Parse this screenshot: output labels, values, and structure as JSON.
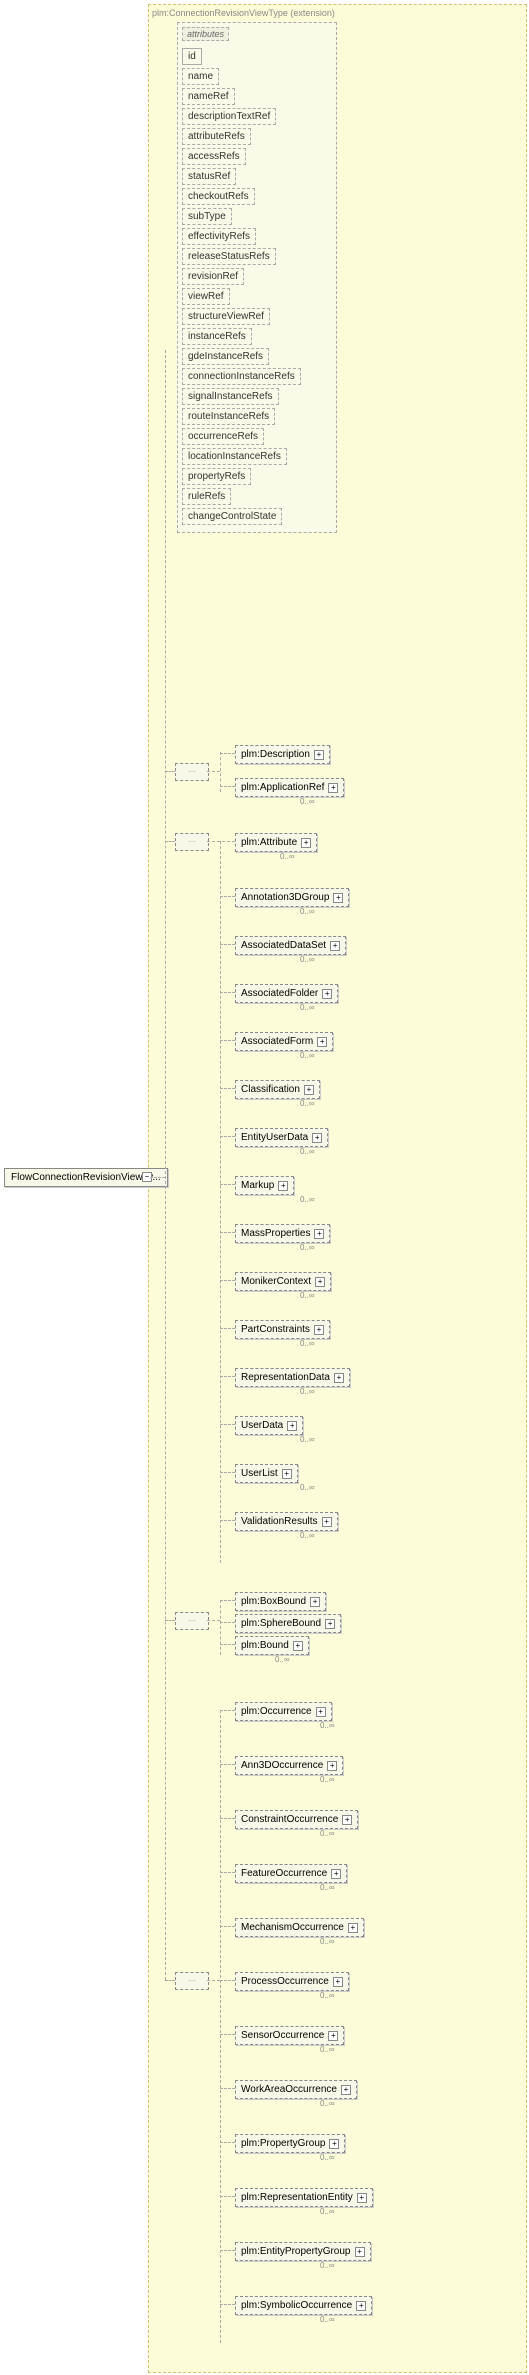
{
  "root": {
    "label": "FlowConnectionRevisionViewTy..."
  },
  "extension": {
    "label": "plm:ConnectionRevisionViewType (extension)"
  },
  "attributes": {
    "title": "attributes",
    "items": [
      {
        "label": "id",
        "solid": true
      },
      {
        "label": "name",
        "solid": false
      },
      {
        "label": "nameRef",
        "solid": false
      },
      {
        "label": "descriptionTextRef",
        "solid": false
      },
      {
        "label": "attributeRefs",
        "solid": false
      },
      {
        "label": "accessRefs",
        "solid": false
      },
      {
        "label": "statusRef",
        "solid": false
      },
      {
        "label": "checkoutRefs",
        "solid": false
      },
      {
        "label": "subType",
        "solid": false
      },
      {
        "label": "effectivityRefs",
        "solid": false
      },
      {
        "label": "releaseStatusRefs",
        "solid": false
      },
      {
        "label": "revisionRef",
        "solid": false
      },
      {
        "label": "viewRef",
        "solid": false
      },
      {
        "label": "structureViewRef",
        "solid": false
      },
      {
        "label": "instanceRefs",
        "solid": false
      },
      {
        "label": "gdeInstanceRefs",
        "solid": false
      },
      {
        "label": "connectionInstanceRefs",
        "solid": false
      },
      {
        "label": "signalInstanceRefs",
        "solid": false
      },
      {
        "label": "routeInstanceRefs",
        "solid": false
      },
      {
        "label": "occurrenceRefs",
        "solid": false
      },
      {
        "label": "locationInstanceRefs",
        "solid": false
      },
      {
        "label": "propertyRefs",
        "solid": false
      },
      {
        "label": "ruleRefs",
        "solid": false
      },
      {
        "label": "changeControlState",
        "solid": false
      }
    ]
  },
  "seq1": {
    "items": [
      {
        "label": "plm:Description",
        "dashed": true,
        "exp": true,
        "card": ""
      },
      {
        "label": "plm:ApplicationRef",
        "dashed": true,
        "exp": true,
        "card": "0..∞"
      }
    ]
  },
  "seq2": {
    "label": "plm:Attribute",
    "card": "0..∞",
    "items": [
      {
        "label": "Annotation3DGroup",
        "card": "0..∞"
      },
      {
        "label": "AssociatedDataSet",
        "card": "0..∞"
      },
      {
        "label": "AssociatedFolder",
        "card": "0..∞"
      },
      {
        "label": "AssociatedForm",
        "card": "0..∞"
      },
      {
        "label": "Classification",
        "card": "0..∞"
      },
      {
        "label": "EntityUserData",
        "card": "0..∞"
      },
      {
        "label": "Markup",
        "card": "0..∞"
      },
      {
        "label": "MassProperties",
        "card": "0..∞"
      },
      {
        "label": "MonikerContext",
        "card": "0..∞"
      },
      {
        "label": "PartConstraints",
        "card": "0..∞"
      },
      {
        "label": "RepresentationData",
        "card": "0..∞"
      },
      {
        "label": "UserData",
        "card": "0..∞"
      },
      {
        "label": "UserList",
        "card": "0..∞"
      },
      {
        "label": "ValidationResults",
        "card": "0..∞"
      }
    ]
  },
  "seq3": {
    "items": [
      {
        "label": "plm:BoxBound",
        "dashed": true,
        "exp": true
      },
      {
        "label": "plm:SphereBound",
        "dashed": true,
        "exp": true
      },
      {
        "label": "plm:Bound",
        "dashed": true,
        "exp": true,
        "card": "0..∞"
      }
    ]
  },
  "seq4": {
    "items": [
      {
        "label": "plm:Occurrence",
        "card": "0..∞"
      },
      {
        "label": "Ann3DOccurrence",
        "card": "0..∞"
      },
      {
        "label": "ConstraintOccurrence",
        "card": "0..∞"
      },
      {
        "label": "FeatureOccurrence",
        "card": "0..∞"
      },
      {
        "label": "MechanismOccurrence",
        "card": "0..∞"
      },
      {
        "label": "ProcessOccurrence",
        "card": "0..∞"
      },
      {
        "label": "SensorOccurrence",
        "card": "0..∞"
      },
      {
        "label": "WorkAreaOccurrence",
        "card": "0..∞"
      },
      {
        "label": "plm:PropertyGroup",
        "card": "0..∞"
      },
      {
        "label": "plm:RepresentationEntity",
        "card": "0..∞"
      },
      {
        "label": "plm:EntityPropertyGroup",
        "card": "0..∞"
      },
      {
        "label": "plm:SymbolicOccurrence",
        "card": "0..∞"
      }
    ]
  }
}
